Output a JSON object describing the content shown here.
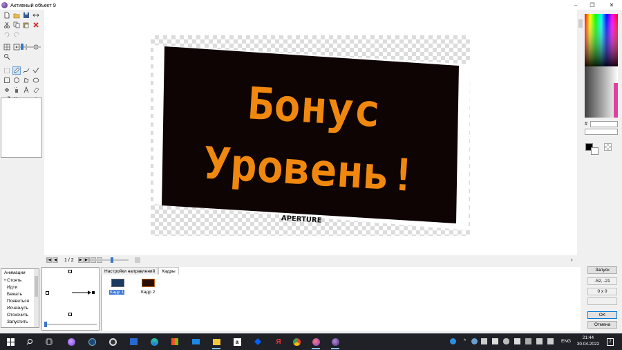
{
  "window": {
    "title": "Активный объект 9",
    "controls": [
      "–",
      "❐",
      "✕"
    ]
  },
  "canvas": {
    "image_heading_line1": "Бонус",
    "image_heading_line2": "Уровень!",
    "image_caption": "APERTURE"
  },
  "frame_nav": {
    "counter": "1 / 2"
  },
  "animations": {
    "header": "Анимации",
    "items": [
      "• Стоять",
      "Идти",
      "Бежать",
      "Появиться",
      "Исчезнуть",
      "Отскочить",
      "Запустить"
    ]
  },
  "tabs": [
    "Настройки направлений",
    "Кадры"
  ],
  "frames": [
    {
      "label": "Кадр 1",
      "selected": true
    },
    {
      "label": "Кадр 2",
      "selected": false
    }
  ],
  "right_panel": {
    "hex_label": "#",
    "launch_button": "Запуск",
    "coords": "-52, -21",
    "size": "0 x 0",
    "ok_button": "OK",
    "cancel_button": "Отмена"
  },
  "taskbar": {
    "lang": "ENG",
    "time": "21:44",
    "date": "30.04.2022",
    "notification_count": "2"
  },
  "colors": {
    "image_text": "#f0880f",
    "image_bg": "#0f0404",
    "selection": "#3a78d8",
    "taskbar": "#1f2127"
  }
}
